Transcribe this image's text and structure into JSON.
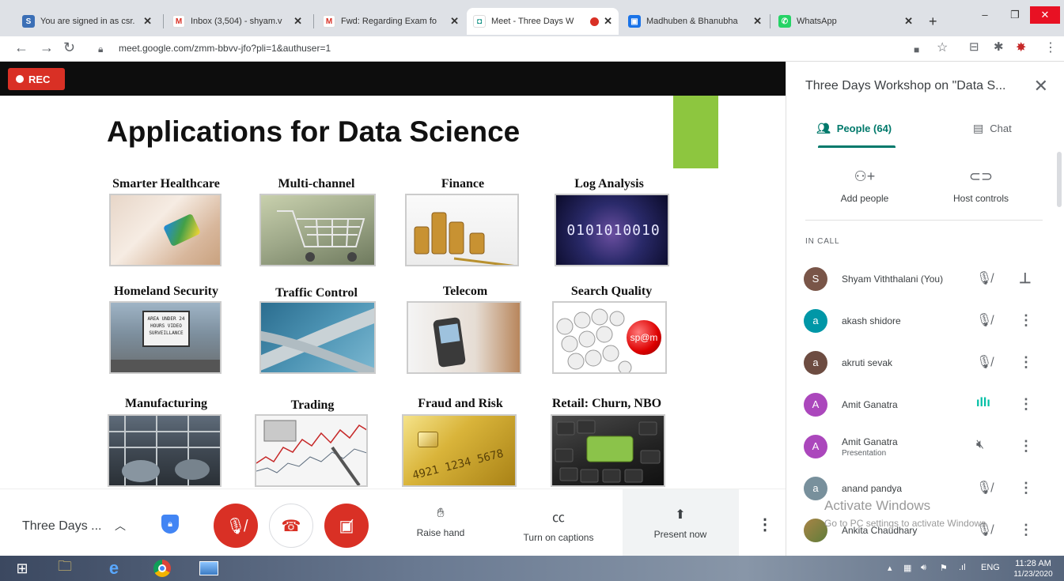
{
  "browser": {
    "tabs": [
      {
        "title": "You are signed in as csr.",
        "favicon": "S",
        "favicon_color": "#3b6fb6"
      },
      {
        "title": "Inbox (3,504) - shyam.v",
        "favicon": "M",
        "favicon_color": "#d93025"
      },
      {
        "title": "Fwd: Regarding Exam fo",
        "favicon": "M",
        "favicon_color": "#d93025"
      },
      {
        "title": "Meet - Three Days W",
        "favicon": "◘",
        "favicon_color": "#00897b"
      },
      {
        "title": "Madhuben & Bhanubha",
        "favicon": "▣",
        "favicon_color": "#1a73e8"
      },
      {
        "title": "WhatsApp",
        "favicon": "✆",
        "favicon_color": "#25d366"
      }
    ],
    "new_tab": "+",
    "window_controls": {
      "minimize": "–",
      "restore": "❐",
      "close": "✕"
    },
    "url": "meet.google.com/zmm-bbvv-jfo?pli=1&authuser=1"
  },
  "stage": {
    "rec_label": "REC",
    "slide": {
      "title": "Applications for Data Science",
      "items": [
        {
          "label": "Smarter Healthcare"
        },
        {
          "label": "Multi-channel"
        },
        {
          "label": "Finance"
        },
        {
          "label": "Log Analysis"
        },
        {
          "label": "Homeland Security"
        },
        {
          "label": "Traffic Control"
        },
        {
          "label": "Telecom"
        },
        {
          "label": "Search Quality"
        },
        {
          "label": "Manufacturing"
        },
        {
          "label": "Trading"
        },
        {
          "label": "Fraud and Risk"
        },
        {
          "label": "Retail: Churn, NBO"
        }
      ],
      "image_texts": {
        "log": "0101010010",
        "sign": "AREA UNDER 24 HOURS VIDEO SURVEILLANCE",
        "spam": "sp@m",
        "card": "4921 1234 5678"
      }
    }
  },
  "panel": {
    "title": "Three Days Workshop on \"Data S...",
    "tabs": {
      "people": "People (64)",
      "chat": "Chat"
    },
    "actions": {
      "add_people": "Add people",
      "host_controls": "Host controls"
    },
    "in_call_label": "IN CALL",
    "participants": [
      {
        "initial": "S",
        "name": "Shyam Viththalani (You)",
        "sub": "",
        "avatar_color": "#795548",
        "mic": "muted",
        "action": "pin"
      },
      {
        "initial": "a",
        "name": "akash shidore",
        "sub": "",
        "avatar_color": "#0097a7",
        "mic": "muted",
        "action": "menu"
      },
      {
        "initial": "a",
        "name": "akruti sevak",
        "sub": "",
        "avatar_color": "#6d4c41",
        "mic": "muted",
        "action": "menu"
      },
      {
        "initial": "A",
        "name": "Amit Ganatra",
        "sub": "",
        "avatar_color": "#ab47bc",
        "mic": "speaking",
        "action": "menu"
      },
      {
        "initial": "A",
        "name": "Amit Ganatra",
        "sub": "Presentation",
        "avatar_color": "#ab47bc",
        "mic": "presentation-muted",
        "action": "menu"
      },
      {
        "initial": "a",
        "name": "anand pandya",
        "sub": "",
        "avatar_color": "#78909c",
        "mic": "muted",
        "action": "menu"
      },
      {
        "initial": "",
        "name": "Ankita Chaudhary",
        "sub": "",
        "avatar_color": "#8d6e3f",
        "mic": "muted",
        "action": "menu"
      }
    ]
  },
  "bottombar": {
    "meeting_name": "Three Days ...",
    "raise_hand": "Raise hand",
    "captions": "Turn on captions",
    "present": "Present now"
  },
  "watermark": {
    "title": "Activate Windows",
    "sub": "Go to PC settings to activate Windows."
  },
  "taskbar": {
    "lang": "ENG",
    "time": "11:28 AM",
    "date": "11/23/2020"
  }
}
